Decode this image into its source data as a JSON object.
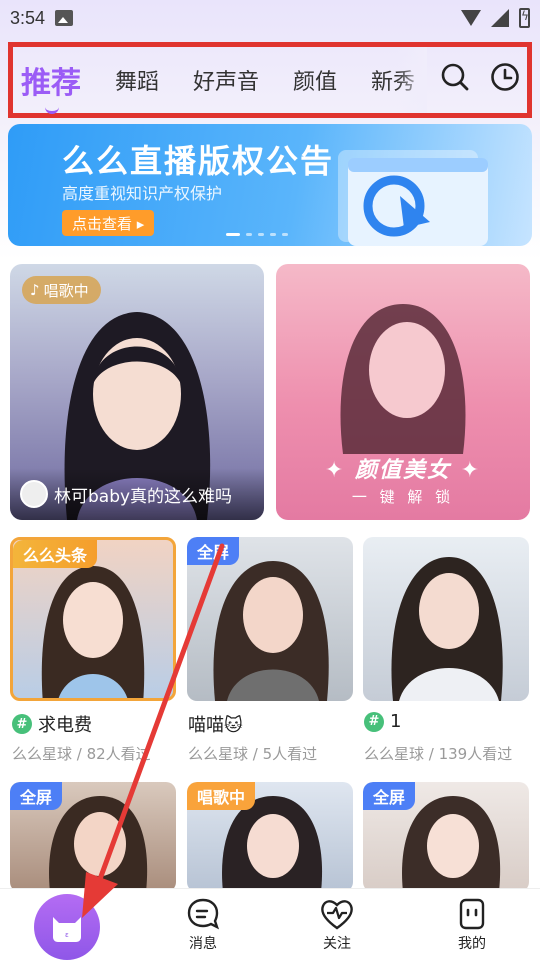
{
  "status_bar": {
    "time": "3:54"
  },
  "tabs": [
    {
      "label": "推荐",
      "active": true
    },
    {
      "label": "舞蹈"
    },
    {
      "label": "好声音"
    },
    {
      "label": "颜值"
    },
    {
      "label": "新秀"
    }
  ],
  "banner": {
    "title": "么么直播版权公告",
    "subtitle": "高度重视知识产权保护",
    "button": "点击查看 ▸"
  },
  "featured": [
    {
      "badge": "唱歌中",
      "caption": "林可baby真的这么难吗"
    },
    {
      "title": "✦ 颜值美女 ✦",
      "subtitle": "一 键 解 锁"
    }
  ],
  "cards": [
    {
      "badge": "么么头条",
      "name": "求电费",
      "meta": "么么星球 / 82人看过"
    },
    {
      "badge": "全屏",
      "name": "喵喵🐱",
      "meta": "么么星球 / 5人看过"
    },
    {
      "badge": "",
      "name": "1",
      "meta": "么么星球 / 139人看过"
    },
    {
      "badge": "全屏"
    },
    {
      "badge": "唱歌中"
    },
    {
      "badge": "全屏"
    }
  ],
  "bottom_nav": {
    "messages": "消息",
    "follow": "关注",
    "mine": "我的"
  },
  "colors": {
    "accent": "#9b5cf6",
    "highlight_box": "#e0342f",
    "arrow": "#e53a36"
  }
}
